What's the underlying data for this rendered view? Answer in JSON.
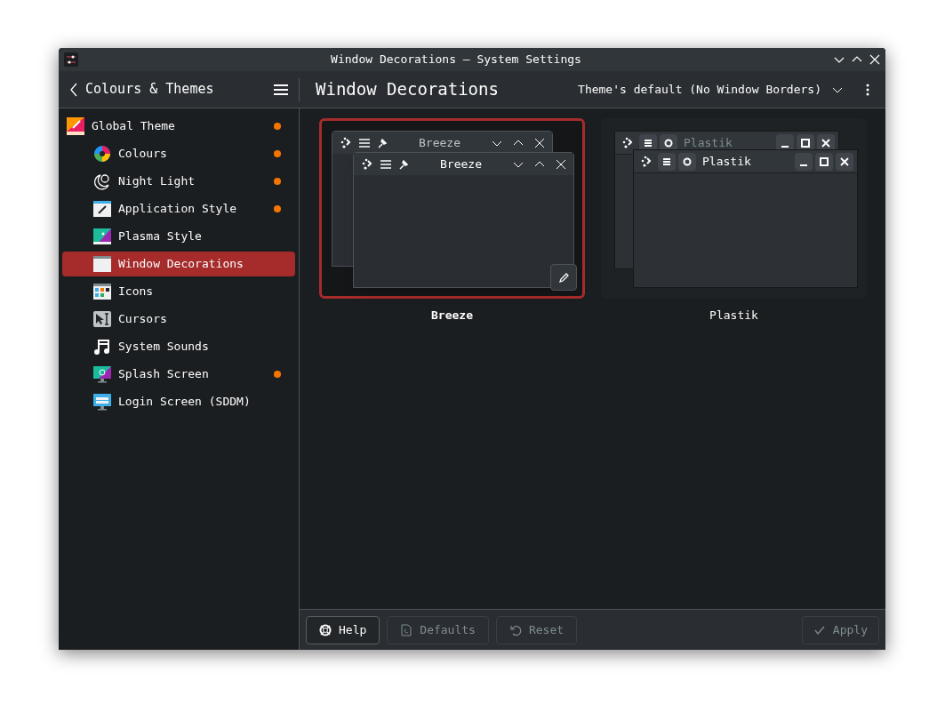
{
  "window": {
    "title": "Window Decorations — System Settings"
  },
  "header": {
    "back_label": "Colours & Themes",
    "page_title": "Window Decorations",
    "border_size": "Theme's default (No Window Borders)"
  },
  "sidebar": {
    "items": [
      {
        "label": "Global Theme",
        "selected": false,
        "modified": true,
        "children": [
          {
            "label": "Colours",
            "selected": false,
            "modified": true
          },
          {
            "label": "Night Light",
            "selected": false,
            "modified": true
          },
          {
            "label": "Application Style",
            "selected": false,
            "modified": true
          },
          {
            "label": "Plasma Style",
            "selected": false,
            "modified": false
          },
          {
            "label": "Window Decorations",
            "selected": true,
            "modified": false
          },
          {
            "label": "Icons",
            "selected": false,
            "modified": false
          },
          {
            "label": "Cursors",
            "selected": false,
            "modified": false
          },
          {
            "label": "System Sounds",
            "selected": false,
            "modified": false
          },
          {
            "label": "Splash Screen",
            "selected": false,
            "modified": true
          },
          {
            "label": "Login Screen (SDDM)",
            "selected": false,
            "modified": false
          }
        ]
      }
    ]
  },
  "decorations": [
    {
      "name": "Breeze",
      "kind": "breeze",
      "selected": true,
      "preview_titles": [
        "Breeze",
        "Breeze"
      ]
    },
    {
      "name": "Plastik",
      "kind": "plastik",
      "selected": false,
      "preview_titles": [
        "Plastik",
        "Plastik"
      ]
    }
  ],
  "footer": {
    "buttons": [
      {
        "label": "Help",
        "kind": "help",
        "disabled": false
      },
      {
        "label": "Defaults",
        "kind": "defaults",
        "disabled": true
      },
      {
        "label": "Reset",
        "kind": "reset",
        "disabled": true
      }
    ],
    "apply": {
      "label": "Apply",
      "disabled": true
    }
  }
}
